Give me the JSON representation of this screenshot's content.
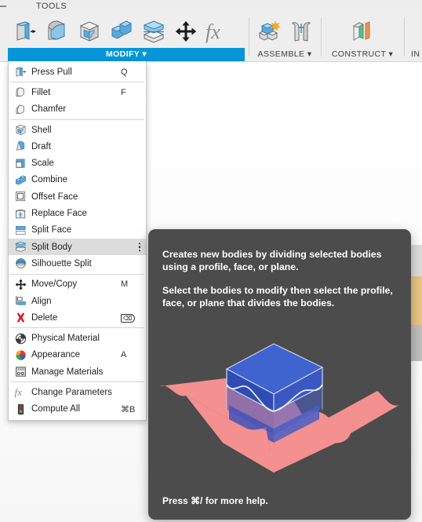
{
  "app": {
    "tab_label": "TOOLS"
  },
  "ribbon": {
    "panels": [
      {
        "id": "modify",
        "title": "MODIFY",
        "active": true,
        "has_dropdown": true,
        "tools": [
          {
            "icon": "press-pull-icon",
            "name": "Press Pull"
          },
          {
            "icon": "fillet-icon",
            "name": "Fillet"
          },
          {
            "icon": "shell-icon",
            "name": "Shell"
          },
          {
            "icon": "combine-icon",
            "name": "Combine"
          },
          {
            "icon": "split-body-icon",
            "name": "Split Body"
          },
          {
            "icon": "move-copy-icon",
            "name": "Move/Copy"
          },
          {
            "icon": "change-parameters-icon",
            "name": "Change Parameters"
          }
        ]
      },
      {
        "id": "assemble",
        "title": "ASSEMBLE",
        "active": false,
        "has_dropdown": true,
        "tools": [
          {
            "icon": "new-component-icon",
            "name": "New Component"
          },
          {
            "icon": "joint-icon",
            "name": "Joint"
          }
        ]
      },
      {
        "id": "construct",
        "title": "CONSTRUCT",
        "active": false,
        "has_dropdown": true,
        "tools": [
          {
            "icon": "offset-plane-icon",
            "name": "Offset Plane"
          }
        ]
      },
      {
        "id": "inspect",
        "title": "IN",
        "active": false,
        "has_dropdown": false,
        "tools": []
      }
    ]
  },
  "menu": {
    "name": "MODIFY",
    "items": [
      {
        "type": "item",
        "icon": "press-pull-icon",
        "label": "Press Pull",
        "shortcut": "Q",
        "highlight": false,
        "overflow": false
      },
      {
        "type": "separator"
      },
      {
        "type": "item",
        "icon": "fillet-icon",
        "label": "Fillet",
        "shortcut": "F",
        "highlight": false,
        "overflow": false
      },
      {
        "type": "item",
        "icon": "chamfer-icon",
        "label": "Chamfer",
        "shortcut": "",
        "highlight": false,
        "overflow": false
      },
      {
        "type": "separator"
      },
      {
        "type": "item",
        "icon": "shell-icon",
        "label": "Shell",
        "shortcut": "",
        "highlight": false,
        "overflow": false
      },
      {
        "type": "item",
        "icon": "draft-icon",
        "label": "Draft",
        "shortcut": "",
        "highlight": false,
        "overflow": false
      },
      {
        "type": "item",
        "icon": "scale-icon",
        "label": "Scale",
        "shortcut": "",
        "highlight": false,
        "overflow": false
      },
      {
        "type": "item",
        "icon": "combine-icon",
        "label": "Combine",
        "shortcut": "",
        "highlight": false,
        "overflow": false
      },
      {
        "type": "item",
        "icon": "offset-face-icon",
        "label": "Offset Face",
        "shortcut": "",
        "highlight": false,
        "overflow": false
      },
      {
        "type": "item",
        "icon": "replace-face-icon",
        "label": "Replace Face",
        "shortcut": "",
        "highlight": false,
        "overflow": false
      },
      {
        "type": "item",
        "icon": "split-face-icon",
        "label": "Split Face",
        "shortcut": "",
        "highlight": false,
        "overflow": false
      },
      {
        "type": "item",
        "icon": "split-body-icon",
        "label": "Split Body",
        "shortcut": "",
        "highlight": true,
        "overflow": true
      },
      {
        "type": "item",
        "icon": "silhouette-split-icon",
        "label": "Silhouette Split",
        "shortcut": "",
        "highlight": false,
        "overflow": false
      },
      {
        "type": "separator"
      },
      {
        "type": "item",
        "icon": "move-copy-icon",
        "label": "Move/Copy",
        "shortcut": "M",
        "highlight": false,
        "overflow": false
      },
      {
        "type": "item",
        "icon": "align-icon",
        "label": "Align",
        "shortcut": "",
        "highlight": false,
        "overflow": false
      },
      {
        "type": "item",
        "icon": "delete-icon",
        "label": "Delete",
        "shortcut": "DEL",
        "highlight": false,
        "overflow": false
      },
      {
        "type": "separator"
      },
      {
        "type": "item",
        "icon": "physical-material-icon",
        "label": "Physical Material",
        "shortcut": "",
        "highlight": false,
        "overflow": false
      },
      {
        "type": "item",
        "icon": "appearance-icon",
        "label": "Appearance",
        "shortcut": "A",
        "highlight": false,
        "overflow": false
      },
      {
        "type": "item",
        "icon": "manage-materials-icon",
        "label": "Manage Materials",
        "shortcut": "",
        "highlight": false,
        "overflow": false
      },
      {
        "type": "separator"
      },
      {
        "type": "item",
        "icon": "change-parameters-icon",
        "label": "Change Parameters",
        "shortcut": "",
        "highlight": false,
        "overflow": false
      },
      {
        "type": "item",
        "icon": "compute-all-icon",
        "label": "Compute All",
        "shortcut": "⌘B",
        "highlight": false,
        "overflow": false
      }
    ]
  },
  "tooltip": {
    "title_for": "Split Body",
    "paragraph_1": "Creates new bodies by dividing selected bodies using a profile, face, or plane.",
    "paragraph_2": "Select the bodies to modify then select the profile, face, or plane that divides the bodies.",
    "footer": "Press ⌘/ for more help.",
    "illustration": "split-body-illustration"
  },
  "colors": {
    "accent_blue": "#0696d7",
    "tooltip_bg": "#4c4c4c",
    "highlight_row": "#dcdcdc",
    "illus_plane": "#f49090",
    "illus_body": "#3b5fc0",
    "edge_panel_gold": "#e8c584"
  }
}
